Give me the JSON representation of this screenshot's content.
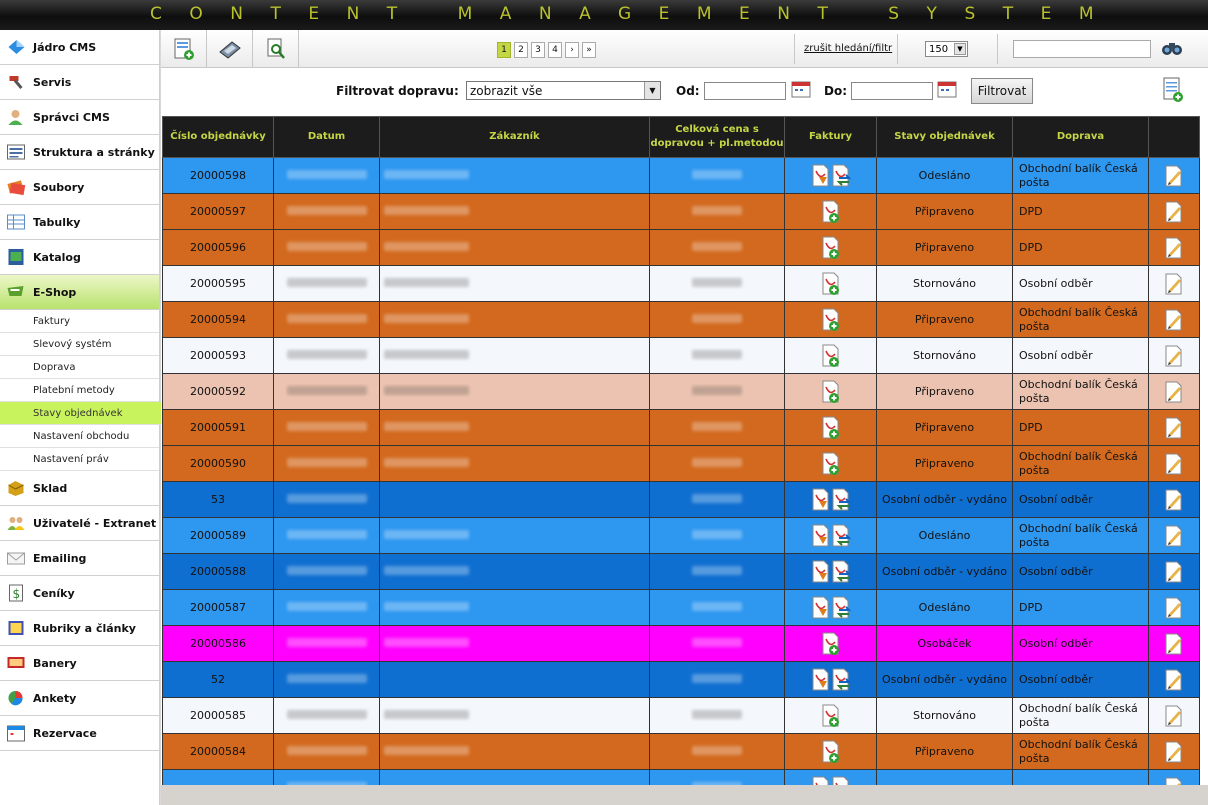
{
  "app": {
    "title": "CONTENT MANAGEMENT SYSTEM"
  },
  "sidebar": {
    "items": [
      {
        "label": "Jádro CMS",
        "icon": "diamond-icon",
        "color": "#2a8de0"
      },
      {
        "label": "Servis",
        "icon": "hammer-icon",
        "color": "#c0392b"
      },
      {
        "label": "Správci CMS",
        "icon": "user-icon",
        "color": "#4caf50"
      },
      {
        "label": "Struktura a stránky",
        "icon": "list-icon",
        "color": "#4a6fa5"
      },
      {
        "label": "Soubory",
        "icon": "files-icon",
        "color": "#e67e22"
      },
      {
        "label": "Tabulky",
        "icon": "table-icon",
        "color": "#5d8cc7"
      },
      {
        "label": "Katalog",
        "icon": "catalog-icon",
        "color": "#2b5e9e"
      },
      {
        "label": "E-Shop",
        "icon": "cart-icon",
        "color": "#5aa02c",
        "active": true
      }
    ],
    "subitems": [
      {
        "label": "Faktury"
      },
      {
        "label": "Slevový systém"
      },
      {
        "label": "Doprava"
      },
      {
        "label": "Platební metody"
      },
      {
        "label": "Stavy objednávek",
        "active": true
      },
      {
        "label": "Nastavení obchodu"
      },
      {
        "label": "Nastavení práv"
      }
    ],
    "items2": [
      {
        "label": "Sklad",
        "icon": "box-icon",
        "color": "#d4a017"
      },
      {
        "label": "Uživatelé - Extranet",
        "icon": "users-icon",
        "color": "#7cb342"
      },
      {
        "label": "Emailing",
        "icon": "envelope-icon",
        "color": "#9e9e9e"
      },
      {
        "label": "Ceníky",
        "icon": "dollar-icon",
        "color": "#2e7d32"
      },
      {
        "label": "Rubriky a články",
        "icon": "book-icon",
        "color": "#3f51b5"
      },
      {
        "label": "Banery",
        "icon": "banner-icon",
        "color": "#c62828"
      },
      {
        "label": "Ankety",
        "icon": "pie-icon",
        "color": "#e53935"
      },
      {
        "label": "Rezervace",
        "icon": "calendar-icon",
        "color": "#1e88e5"
      }
    ]
  },
  "toolbar": {
    "pages": [
      "1",
      "2",
      "3",
      "4",
      "›",
      "»"
    ],
    "current_page": "1",
    "reset_label": "zrušit hledání/filtr",
    "per_page": "150"
  },
  "filter": {
    "label": "Filtrovat dopravu:",
    "select_value": "zobrazit vše",
    "from_label": "Od:",
    "to_label": "Do:",
    "button_label": "Filtrovat"
  },
  "table": {
    "columns": [
      "Číslo objednávky",
      "Datum",
      "Zákazník",
      "Celková cena s dopravou + pl.metodou",
      "Faktury",
      "Stavy objednávek",
      "Doprava",
      ""
    ],
    "rows": [
      {
        "id": "20000598",
        "status": "Odesláno",
        "doprava": "Obchodní balík Česká pošta",
        "bg": "#2e97f0",
        "inv": 2
      },
      {
        "id": "20000597",
        "status": "Připraveno",
        "doprava": "DPD",
        "bg": "#d2691e",
        "inv": 1
      },
      {
        "id": "20000596",
        "status": "Připraveno",
        "doprava": "DPD",
        "bg": "#d2691e",
        "inv": 1
      },
      {
        "id": "20000595",
        "status": "Stornováno",
        "doprava": "Osobní odběr",
        "bg": "#f4f8fc",
        "inv": 1
      },
      {
        "id": "20000594",
        "status": "Připraveno",
        "doprava": "Obchodní balík Česká pošta",
        "bg": "#d2691e",
        "inv": 1
      },
      {
        "id": "20000593",
        "status": "Stornováno",
        "doprava": "Osobní odběr",
        "bg": "#f4f8fc",
        "inv": 1
      },
      {
        "id": "20000592",
        "status": "Připraveno",
        "doprava": "Obchodní balík Česká pošta",
        "bg": "#ecc3b0",
        "inv": 1
      },
      {
        "id": "20000591",
        "status": "Připraveno",
        "doprava": "DPD",
        "bg": "#d2691e",
        "inv": 1
      },
      {
        "id": "20000590",
        "status": "Připraveno",
        "doprava": "Obchodní balík Česká pošta",
        "bg": "#d2691e",
        "inv": 1
      },
      {
        "id": "53",
        "status": "Osobní odběr - vydáno",
        "doprava": "Osobní odběr",
        "bg": "#0f6fd0",
        "inv": 2
      },
      {
        "id": "20000589",
        "status": "Odesláno",
        "doprava": "Obchodní balík Česká pošta",
        "bg": "#2e97f0",
        "inv": 2
      },
      {
        "id": "20000588",
        "status": "Osobní odběr - vydáno",
        "doprava": "Osobní odběr",
        "bg": "#0f6fd0",
        "inv": 2
      },
      {
        "id": "20000587",
        "status": "Odesláno",
        "doprava": "DPD",
        "bg": "#2e97f0",
        "inv": 2
      },
      {
        "id": "20000586",
        "status": "Osobáček",
        "doprava": "Osobní odběr",
        "bg": "#ff00ff",
        "inv": 1
      },
      {
        "id": "52",
        "status": "Osobní odběr - vydáno",
        "doprava": "Osobní odběr",
        "bg": "#0f6fd0",
        "inv": 2
      },
      {
        "id": "20000585",
        "status": "Stornováno",
        "doprava": "Obchodní balík Česká pošta",
        "bg": "#f4f8fc",
        "inv": 1
      },
      {
        "id": "20000584",
        "status": "Připraveno",
        "doprava": "Obchodní balík Česká pošta",
        "bg": "#d2691e",
        "inv": 1
      },
      {
        "id": "",
        "status": "",
        "doprava": "",
        "bg": "#2e97f0",
        "inv": 2
      }
    ]
  }
}
